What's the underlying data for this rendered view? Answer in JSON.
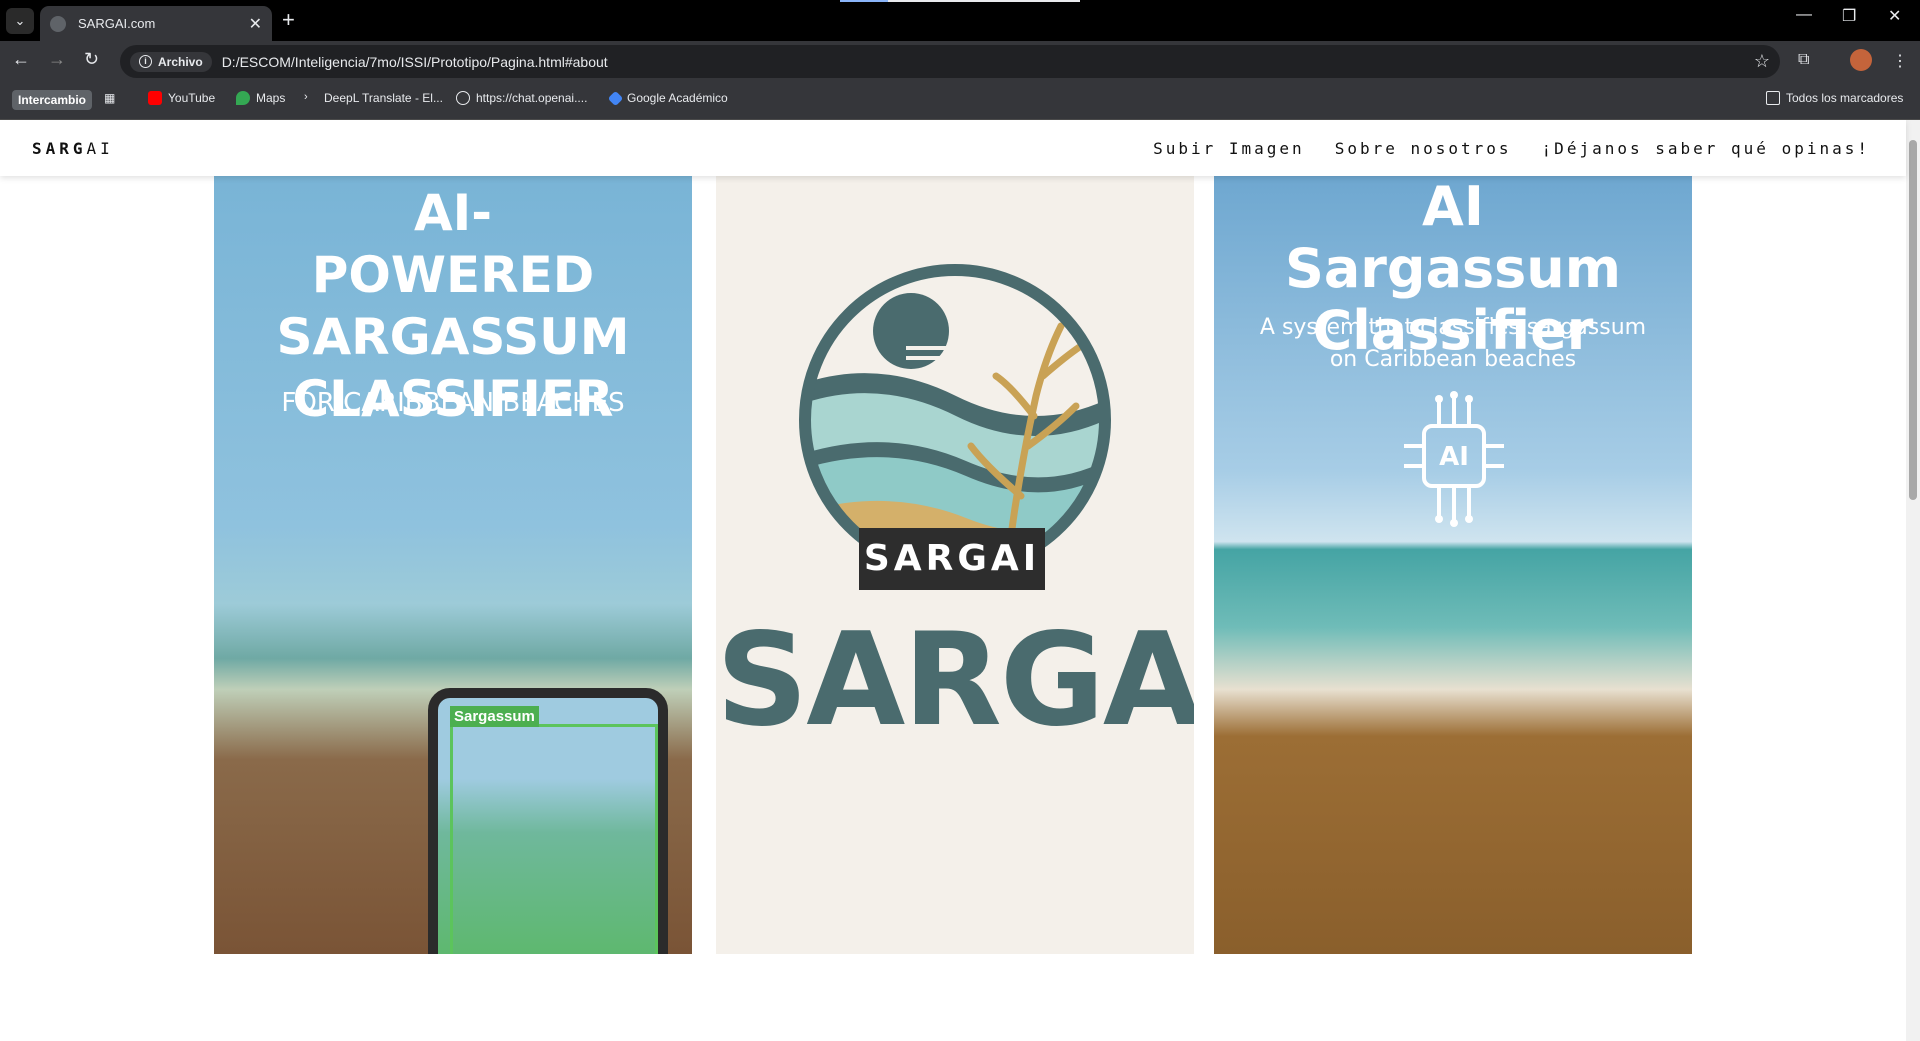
{
  "browser": {
    "tab_title": "SARGAI.com",
    "new_tab": "+",
    "address_chip": "Archivo",
    "url": "D:/ESCOM/Inteligencia/7mo/ISSI/Prototipo/Pagina.html#about",
    "bookmarks": [
      {
        "label": "Intercambio"
      },
      {
        "label": "YouTube"
      },
      {
        "label": "Maps"
      },
      {
        "label": "DeepL Translate - El..."
      },
      {
        "label": "https://chat.openai...."
      },
      {
        "label": "Google Académico"
      }
    ],
    "all_bookmarks": "Todos los marcadores"
  },
  "site": {
    "brand_main": "SARG",
    "brand_ai": "AI",
    "nav": [
      "Subir Imagen",
      "Sobre nosotros",
      "¡Déjanos saber qué opinas!"
    ]
  },
  "panels": {
    "left": {
      "title": "AI-POWERED SARGASSUM CLASSIFIER",
      "subtitle": "FOR CARIBBEAN BEACHES",
      "tablet_label": "Sargassum"
    },
    "center": {
      "badge": "SARGAI",
      "wordmark": "SARGAI"
    },
    "right": {
      "title": "AI Sargassum Classifier",
      "subtitle": "A system that classifies sargassum on Caribbean beaches",
      "chip_label": "AI"
    }
  }
}
